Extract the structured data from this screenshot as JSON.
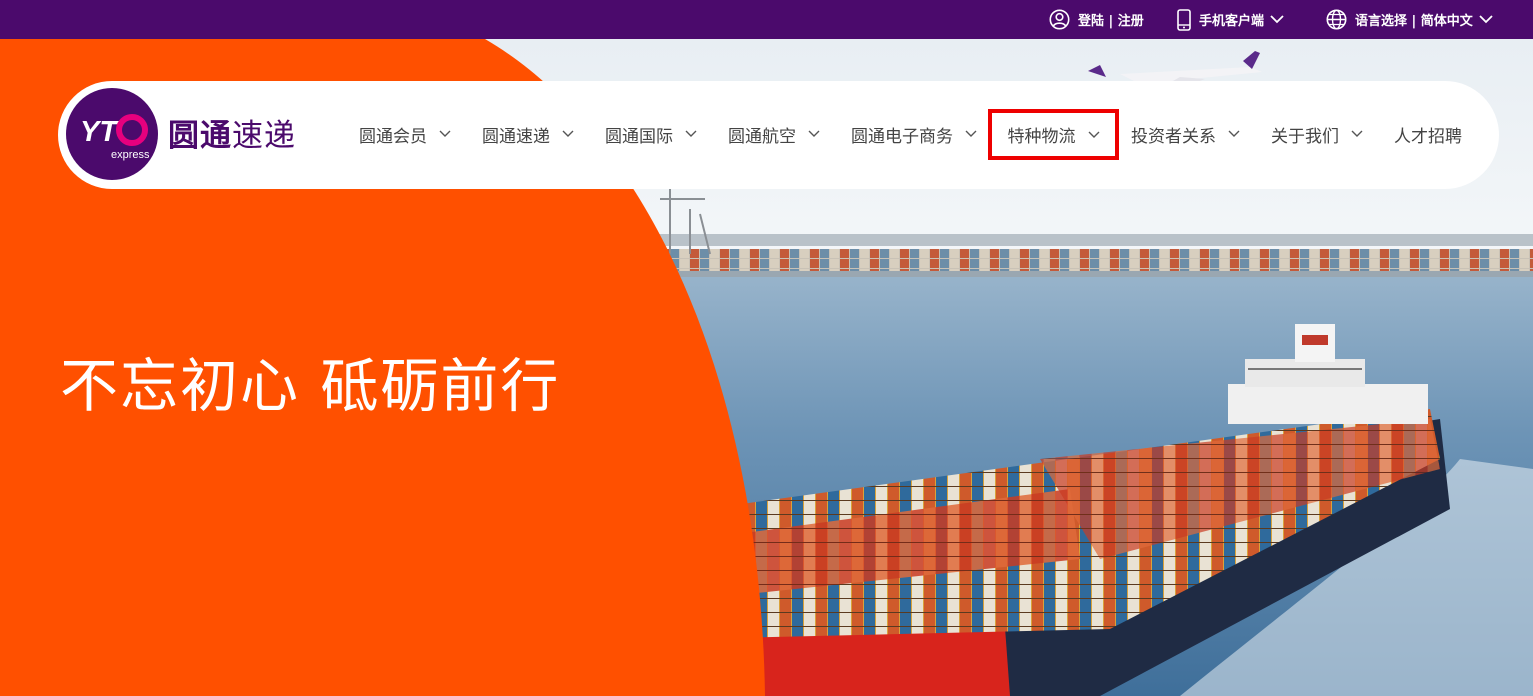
{
  "topbar": {
    "login_label": "登陆 | 注册",
    "mobile_label": "手机客户端",
    "language_label": "语言选择 | 简体中文",
    "background_color": "#4b0a6c"
  },
  "brand": {
    "logo_letters": "YTO",
    "logo_sub": "express",
    "name_bold": "圆通",
    "name_light": "速递",
    "primary_color": "#4b0a6c",
    "accent_color": "#e6007e"
  },
  "nav": {
    "items": [
      {
        "label": "圆通会员",
        "has_dropdown": true
      },
      {
        "label": "圆通速递",
        "has_dropdown": true
      },
      {
        "label": "圆通国际",
        "has_dropdown": true
      },
      {
        "label": "圆通航空",
        "has_dropdown": true
      },
      {
        "label": "圆通电子商务",
        "has_dropdown": true
      },
      {
        "label": "特种物流",
        "has_dropdown": true,
        "highlighted": true
      },
      {
        "label": "投资者关系",
        "has_dropdown": true
      },
      {
        "label": "关于我们",
        "has_dropdown": true
      },
      {
        "label": "人才招聘",
        "has_dropdown": false
      }
    ]
  },
  "hero": {
    "slogan": "不忘初心 砥砺前行",
    "orange_color": "#ff5000",
    "highlight_color": "#ee0000"
  },
  "icons": {
    "user": "user-circle-icon",
    "mobile": "mobile-phone-icon",
    "globe": "globe-icon",
    "chevron": "chevron-down-icon"
  }
}
